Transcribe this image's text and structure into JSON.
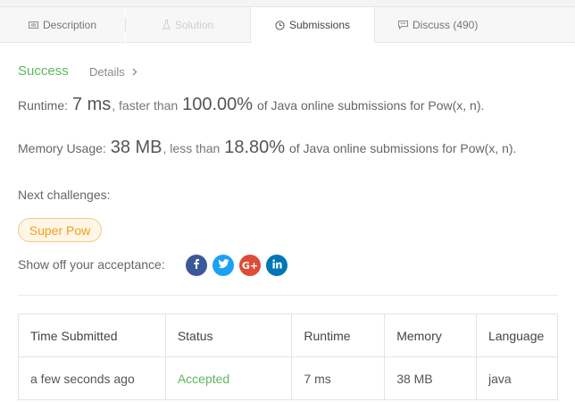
{
  "tabs": [
    {
      "label": "Description",
      "icon": "document-icon",
      "state": "normal"
    },
    {
      "label": "Solution",
      "icon": "flask-icon",
      "state": "disabled"
    },
    {
      "label": "Submissions",
      "icon": "clock-icon",
      "state": "active"
    },
    {
      "label": "Discuss (490)",
      "icon": "comment-icon",
      "state": "normal"
    }
  ],
  "result": {
    "status": "Success",
    "details_label": "Details"
  },
  "runtime": {
    "label": "Runtime:",
    "value": "7 ms",
    "compare_text": ", faster than",
    "percent": "100.00%",
    "suffix": "of Java online submissions for Pow(x, n)."
  },
  "memory": {
    "label": "Memory Usage:",
    "value": "38 MB",
    "compare_text": ", less than",
    "percent": "18.80%",
    "suffix": "of Java online submissions for Pow(x, n)."
  },
  "next_challenges": {
    "label": "Next challenges:",
    "items": [
      "Super Pow"
    ]
  },
  "share": {
    "label": "Show off your acceptance:",
    "colors": {
      "facebook": "#3b5998",
      "twitter": "#1da1f2",
      "google": "#dd4b39",
      "linkedin": "#0077b5"
    }
  },
  "submissions": {
    "headers": [
      "Time Submitted",
      "Status",
      "Runtime",
      "Memory",
      "Language"
    ],
    "rows": [
      {
        "time": "a few seconds ago",
        "status": "Accepted",
        "runtime": "7 ms",
        "memory": "38 MB",
        "language": "java"
      }
    ]
  },
  "colors": {
    "success": "#5cb85c",
    "pill_text": "#f0a020",
    "pill_bg": "#fff6e6"
  }
}
